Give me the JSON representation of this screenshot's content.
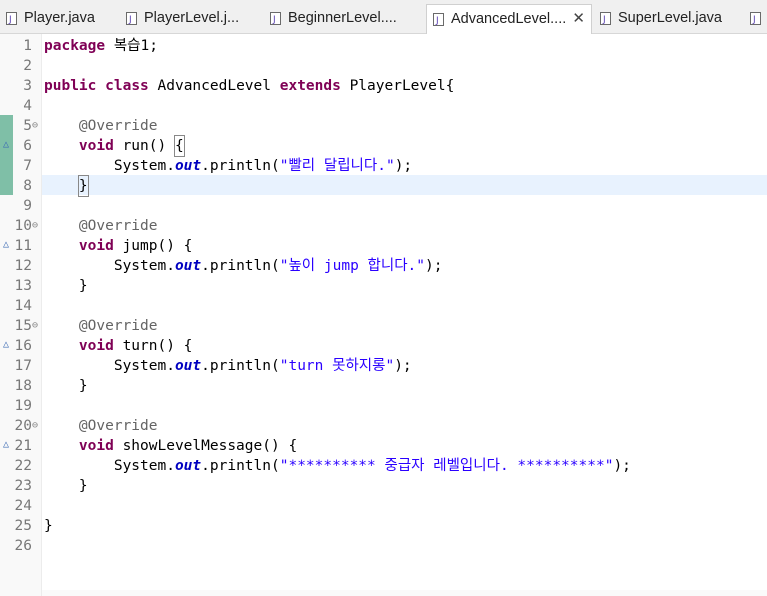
{
  "tabs": [
    {
      "label": "Player.java",
      "active": false
    },
    {
      "label": "PlayerLevel.j...",
      "active": false
    },
    {
      "label": "BeginnerLevel....",
      "active": false
    },
    {
      "label": "AdvancedLevel....",
      "active": true
    },
    {
      "label": "SuperLevel.java",
      "active": false
    }
  ],
  "close_symbol": "✕",
  "lines": [
    {
      "n": "1",
      "code": [
        {
          "t": "package",
          "c": "kw"
        },
        {
          "t": " 복습1;",
          "c": ""
        }
      ]
    },
    {
      "n": "2",
      "code": []
    },
    {
      "n": "3",
      "code": [
        {
          "t": "public",
          "c": "kw"
        },
        {
          "t": " ",
          "c": ""
        },
        {
          "t": "class",
          "c": "kw"
        },
        {
          "t": " AdvancedLevel ",
          "c": ""
        },
        {
          "t": "extends",
          "c": "kw"
        },
        {
          "t": " PlayerLevel{",
          "c": ""
        }
      ]
    },
    {
      "n": "4",
      "code": []
    },
    {
      "n": "5",
      "fold": true,
      "code": [
        {
          "t": "    ",
          "c": ""
        },
        {
          "t": "@Override",
          "c": "ann"
        }
      ]
    },
    {
      "n": "6",
      "override": true,
      "code": [
        {
          "t": "    ",
          "c": ""
        },
        {
          "t": "void",
          "c": "kw"
        },
        {
          "t": " run() ",
          "c": ""
        },
        {
          "t": "{",
          "c": "box"
        }
      ]
    },
    {
      "n": "7",
      "code": [
        {
          "t": "        System.",
          "c": ""
        },
        {
          "t": "out",
          "c": "fld"
        },
        {
          "t": ".println(",
          "c": ""
        },
        {
          "t": "\"빨리 달립니다.\"",
          "c": "str"
        },
        {
          "t": ");",
          "c": ""
        }
      ]
    },
    {
      "n": "8",
      "current": true,
      "code": [
        {
          "t": "    ",
          "c": ""
        },
        {
          "t": "}",
          "c": "box"
        }
      ]
    },
    {
      "n": "9",
      "code": []
    },
    {
      "n": "10",
      "fold": true,
      "code": [
        {
          "t": "    ",
          "c": ""
        },
        {
          "t": "@Override",
          "c": "ann"
        }
      ]
    },
    {
      "n": "11",
      "override": true,
      "code": [
        {
          "t": "    ",
          "c": ""
        },
        {
          "t": "void",
          "c": "kw"
        },
        {
          "t": " jump() {",
          "c": ""
        }
      ]
    },
    {
      "n": "12",
      "code": [
        {
          "t": "        System.",
          "c": ""
        },
        {
          "t": "out",
          "c": "fld"
        },
        {
          "t": ".println(",
          "c": ""
        },
        {
          "t": "\"높이 jump 합니다.\"",
          "c": "str"
        },
        {
          "t": ");",
          "c": ""
        }
      ]
    },
    {
      "n": "13",
      "code": [
        {
          "t": "    }",
          "c": ""
        }
      ]
    },
    {
      "n": "14",
      "code": []
    },
    {
      "n": "15",
      "fold": true,
      "code": [
        {
          "t": "    ",
          "c": ""
        },
        {
          "t": "@Override",
          "c": "ann"
        }
      ]
    },
    {
      "n": "16",
      "override": true,
      "code": [
        {
          "t": "    ",
          "c": ""
        },
        {
          "t": "void",
          "c": "kw"
        },
        {
          "t": " turn() {",
          "c": ""
        }
      ]
    },
    {
      "n": "17",
      "code": [
        {
          "t": "        System.",
          "c": ""
        },
        {
          "t": "out",
          "c": "fld"
        },
        {
          "t": ".println(",
          "c": ""
        },
        {
          "t": "\"turn 못하지롱\"",
          "c": "str"
        },
        {
          "t": ");",
          "c": ""
        }
      ]
    },
    {
      "n": "18",
      "code": [
        {
          "t": "    }",
          "c": ""
        }
      ]
    },
    {
      "n": "19",
      "code": []
    },
    {
      "n": "20",
      "fold": true,
      "code": [
        {
          "t": "    ",
          "c": ""
        },
        {
          "t": "@Override",
          "c": "ann"
        }
      ]
    },
    {
      "n": "21",
      "override": true,
      "code": [
        {
          "t": "    ",
          "c": ""
        },
        {
          "t": "void",
          "c": "kw"
        },
        {
          "t": " showLevelMessage() {",
          "c": ""
        }
      ]
    },
    {
      "n": "22",
      "code": [
        {
          "t": "        System.",
          "c": ""
        },
        {
          "t": "out",
          "c": "fld"
        },
        {
          "t": ".println(",
          "c": ""
        },
        {
          "t": "\"********** 중급자 레벨입니다. **********\"",
          "c": "str"
        },
        {
          "t": ");",
          "c": ""
        }
      ]
    },
    {
      "n": "23",
      "code": [
        {
          "t": "    }",
          "c": ""
        }
      ]
    },
    {
      "n": "24",
      "code": []
    },
    {
      "n": "25",
      "code": [
        {
          "t": "}",
          "c": ""
        }
      ]
    },
    {
      "n": "26",
      "code": []
    }
  ],
  "colors": {
    "keyword": "#7f0055",
    "string": "#2a00ff",
    "annotation": "#646464",
    "field": "#0000c0",
    "current_line": "#e8f2fe",
    "change_bar": "#7fbfa7"
  }
}
